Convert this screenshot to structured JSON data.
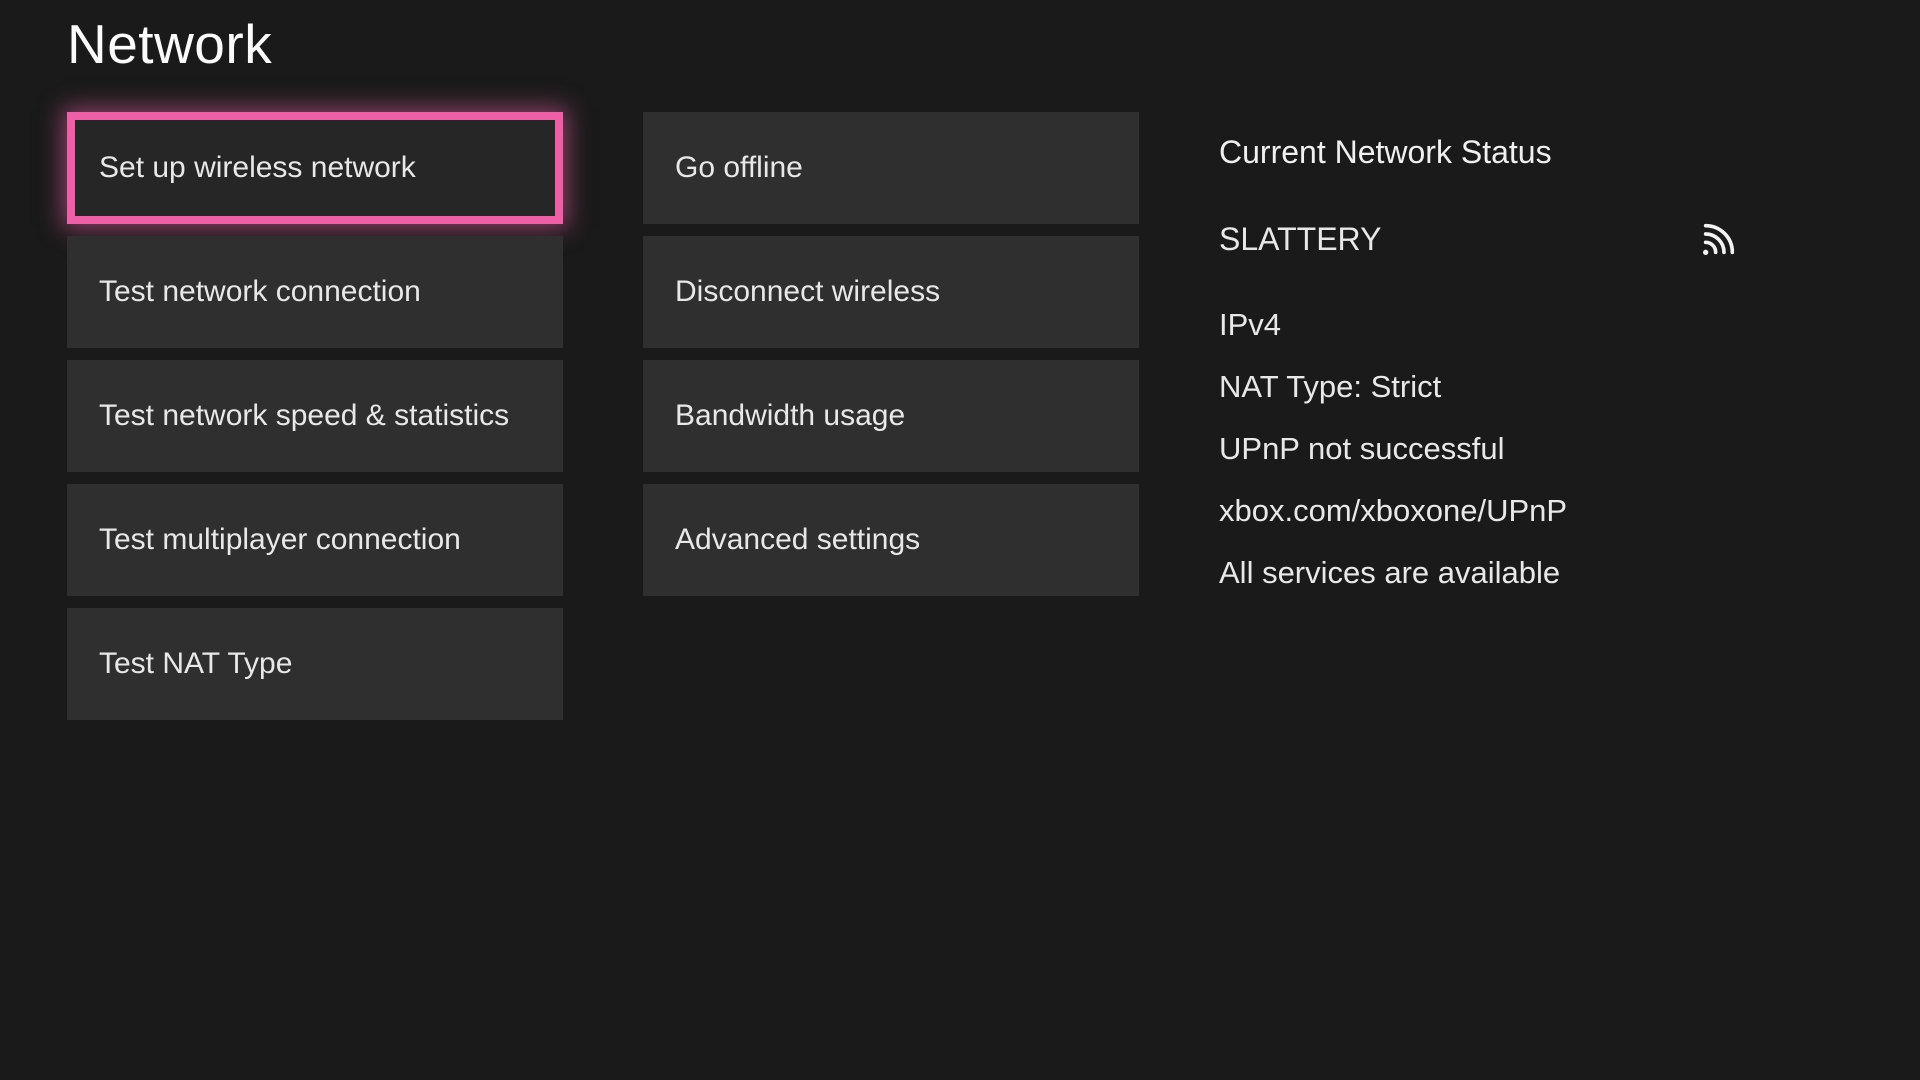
{
  "title": "Network",
  "columns": {
    "left": [
      {
        "id": "setup-wireless",
        "label": "Set up wireless network",
        "selected": true
      },
      {
        "id": "test-connection",
        "label": "Test network connection",
        "selected": false
      },
      {
        "id": "test-speed",
        "label": "Test network speed & statistics",
        "selected": false
      },
      {
        "id": "test-multiplayer",
        "label": "Test multiplayer connection",
        "selected": false
      },
      {
        "id": "test-nat",
        "label": "Test NAT Type",
        "selected": false
      }
    ],
    "right": [
      {
        "id": "go-offline",
        "label": "Go offline",
        "selected": false
      },
      {
        "id": "disconnect-wireless",
        "label": "Disconnect wireless",
        "selected": false
      },
      {
        "id": "bandwidth-usage",
        "label": "Bandwidth usage",
        "selected": false
      },
      {
        "id": "advanced-settings",
        "label": "Advanced settings",
        "selected": false
      }
    ]
  },
  "status": {
    "heading": "Current Network Status",
    "ssid": "SLATTERY",
    "ip_version": "IPv4",
    "nat_type": "NAT Type: Strict",
    "upnp": "UPnP not successful",
    "upnp_url": "xbox.com/xboxone/UPnP",
    "services": "All services are available"
  }
}
